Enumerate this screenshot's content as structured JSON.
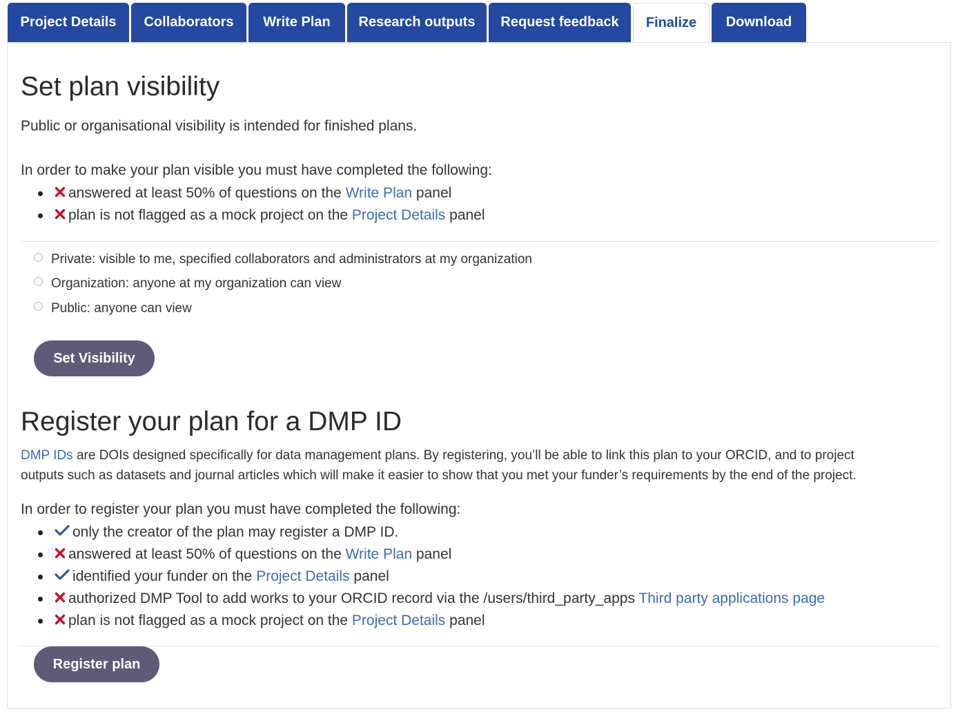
{
  "tabs": [
    {
      "label": "Project Details"
    },
    {
      "label": "Collaborators"
    },
    {
      "label": "Write Plan"
    },
    {
      "label": "Research outputs"
    },
    {
      "label": "Request feedback"
    },
    {
      "label": "Finalize"
    },
    {
      "label": "Download"
    }
  ],
  "visibility": {
    "title": "Set plan visibility",
    "intro": "Public or organisational visibility is intended for finished plans.",
    "requirements_heading": "In order to make your plan visible you must have completed the following:",
    "requirements": [
      {
        "status": "x",
        "before": "answered at least 50% of questions on the ",
        "link": "Write Plan",
        "after": " panel"
      },
      {
        "status": "x",
        "before": "plan is not flagged as a mock project on the ",
        "link": "Project Details",
        "after": " panel"
      }
    ],
    "options": [
      {
        "label": "Private: visible to me, specified collaborators and administrators at my organization"
      },
      {
        "label": "Organization: anyone at my organization can view"
      },
      {
        "label": "Public: anyone can view"
      }
    ],
    "button_label": "Set Visibility"
  },
  "register": {
    "title": "Register your plan for a DMP ID",
    "desc_link": "DMP IDs",
    "desc_line1": " are DOIs designed specifically for data management plans. By registering, you’ll be able to link this plan to your ORCID, and to project",
    "desc_line2": "outputs such as datasets and journal articles which will make it easier to show that you met your funder’s requirements by the end of the project.",
    "requirements_heading": "In order to register your plan you must have completed the following:",
    "requirements": [
      {
        "status": "check",
        "before": "only the creator of the plan may register a DMP ID.",
        "link": "",
        "after": ""
      },
      {
        "status": "x",
        "before": "answered at least 50% of questions on the ",
        "link": "Write Plan",
        "after": " panel"
      },
      {
        "status": "check",
        "before": "identified your funder on the ",
        "link": "Project Details",
        "after": " panel"
      },
      {
        "status": "x",
        "before": "authorized DMP Tool to add works to your ORCID record via the /users/third_party_apps ",
        "link": "Third party applications page",
        "after": ""
      },
      {
        "status": "x",
        "before": "plan is not flagged as a mock project on the ",
        "link": "Project Details",
        "after": " panel"
      }
    ],
    "button_label": "Register plan"
  },
  "colors": {
    "tab_bg": "#2349a0",
    "link": "#3d6bb3",
    "x_red": "#c8102e",
    "check_blue": "#2c5d8f",
    "button_bg": "#5e5a78"
  }
}
